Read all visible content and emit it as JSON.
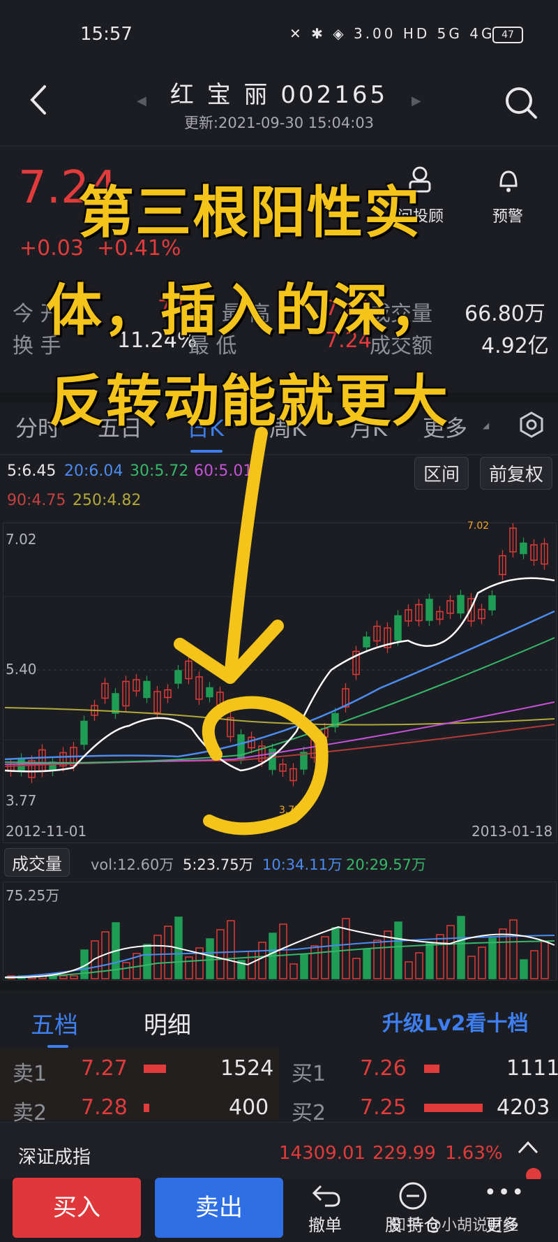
{
  "status": {
    "time": "15:57",
    "speed": "3.00\nKB/S",
    "battery": "47",
    "icons_text": "✕ ✱ ◈ 3.00 HD 5G 4G"
  },
  "header": {
    "title": "红 宝 丽 002165",
    "updated": "更新:2021-09-30 15:04:03"
  },
  "quote": {
    "price": "7.24",
    "change": "+0.03",
    "change_pct": "+0.41%",
    "advisor_label": "问投顾",
    "alert_label": "预警",
    "row1": {
      "l1": "今 开",
      "v1": "7.51",
      "l2": "最 高",
      "v2": "7.61",
      "l3": "成交量",
      "v3": "66.80万"
    },
    "row2": {
      "l1": "换 手",
      "v1": "11.24%",
      "l2": "最 低",
      "v2": "7.24",
      "l3": "成交额",
      "v3": "4.92亿"
    }
  },
  "overlay": {
    "line1": "第三根阳性实",
    "line2": "体，插入的深，",
    "line3": "反转动能就更大"
  },
  "tabs": [
    "分时",
    "五日",
    "日K",
    "周K",
    "月K",
    "更多"
  ],
  "ma": {
    "ma5": "5:6.45",
    "ma20": "20:6.04",
    "ma30": "30:5.72",
    "ma60": "60:5.01",
    "ma90": "90:4.75",
    "ma250": "250:4.82",
    "range_btn": "区间",
    "adjust_btn": "前复权"
  },
  "chart_labels": {
    "y_top": "7.02",
    "y_mid": "5.40",
    "y_low": "3.77",
    "x_start": "2012-11-01",
    "x_end": "2013-01-18",
    "high_mark": "7.02",
    "low_mark": "3.77"
  },
  "volume": {
    "selector": "成交量",
    "vol": "vol:12.60万",
    "v5": "5:23.75万",
    "v10": "10:34.11万",
    "v20": "20:29.57万",
    "ytop": "75.25万"
  },
  "depth": {
    "tab_five": "五档",
    "tab_detail": "明细",
    "upgrade": "升级Lv2看十档",
    "asks": [
      {
        "label": "卖1",
        "price": "7.27",
        "qty": "1524"
      },
      {
        "label": "卖2",
        "price": "7.28",
        "qty": "400"
      }
    ],
    "bids": [
      {
        "label": "买1",
        "price": "7.26",
        "qty": "1111"
      },
      {
        "label": "买2",
        "price": "7.25",
        "qty": "4203"
      }
    ]
  },
  "index": {
    "name": "深证成指",
    "value": "14309.01",
    "change": "229.99",
    "pct": "1.63%"
  },
  "bottom": {
    "buy": "买入",
    "sell": "卖出",
    "cancel": "撤单",
    "holdings": "股 持仓",
    "more": "更多",
    "watermark": "知乎 @小胡说财经"
  },
  "colors": {
    "up": "#e23b3b",
    "down": "#1f9d55",
    "accent": "#3d7ef0",
    "overlay": "#f5c41a"
  }
}
